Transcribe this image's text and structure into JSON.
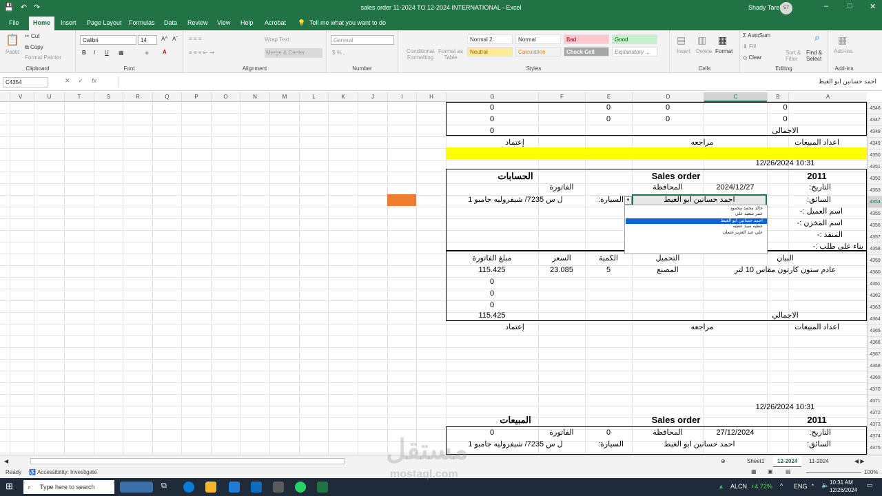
{
  "window": {
    "title": "sales order 11-2024 TO 12-2024 INTERNATIONAL  -  Excel",
    "user": "Shady Tarek",
    "avatar": "ST",
    "controls": [
      "–",
      "□",
      "✕"
    ]
  },
  "menu": {
    "tabs": [
      "File",
      "Home",
      "Insert",
      "Page Layout",
      "Formulas",
      "Data",
      "Review",
      "View",
      "Help",
      "Acrobat"
    ],
    "tell": "Tell me what you want to do"
  },
  "ribbon": {
    "clipboard": {
      "paste": "Paste",
      "cut": "Cut",
      "copy": "Copy",
      "painter": "Format Painter",
      "label": "Clipboard"
    },
    "font": {
      "name": "Calibri",
      "size": "14",
      "label": "Font"
    },
    "alignment": {
      "wrap": "Wrap Text",
      "merge": "Merge & Center",
      "label": "Alignment"
    },
    "number": {
      "format": "General",
      "label": "Number"
    },
    "styles": {
      "cond": "Conditional Formatting",
      "table": "Format as Table",
      "items": [
        "Normal 2",
        "Normal",
        "Bad",
        "Good",
        "Neutral",
        "Calculation",
        "Check Cell",
        "Explanatory ..."
      ],
      "label": "Styles"
    },
    "cells": {
      "insert": "Insert",
      "delete": "Delete",
      "format": "Format",
      "label": "Cells"
    },
    "editing": {
      "autosum": "AutoSum",
      "fill": "Fill",
      "clear": "Clear",
      "sort": "Sort & Filter",
      "find": "Find & Select",
      "label": "Editing"
    },
    "addins": {
      "btn": "Add-ins",
      "label": "Add-ins"
    }
  },
  "formula": {
    "namebox": "C4354",
    "value": "احمد حسانين ابو الغيط"
  },
  "columns": [
    "V",
    "U",
    "T",
    "S",
    "R",
    "Q",
    "P",
    "O",
    "N",
    "M",
    "L",
    "K",
    "J",
    "I",
    "H",
    "G",
    "F",
    "E",
    "D",
    "C",
    "B",
    "A"
  ],
  "rows": [
    "4346",
    "4347",
    "4348",
    "4349",
    "4350",
    "4351",
    "4352",
    "4353",
    "4354",
    "4355",
    "4356",
    "4357",
    "4358",
    "4359",
    "4360",
    "4361",
    "4362",
    "4363",
    "4364",
    "4365",
    "4366",
    "4367",
    "4368",
    "4369",
    "4370",
    "4371",
    "4372",
    "4373",
    "4374",
    "4375"
  ],
  "sheet": {
    "zero": "0",
    "total": "الاجمالي",
    "total2": "الاجمالى",
    "sales_count": "اعداد المبيعات",
    "review": "مراجعه",
    "approve": "إعتماد",
    "datetime": "12/26/2024 10:31",
    "year": "2011",
    "sales_order": "Sales order",
    "accounts": "الحسابات",
    "sales": "المبيعات",
    "date_lbl": "التاريخ:",
    "date1": "2024/12/27",
    "date2": "27/12/2024",
    "province": "المحافظة",
    "invoice": "الفاتورة",
    "driver_lbl": "السائق:",
    "driver": "احمد حسانين ابو الغيط",
    "car_lbl": "السيارة:",
    "car": "ل س 7235/ شيفروليه جامبو 1",
    "client": "اسم العميل :-",
    "store": "اسم المخزن :-",
    "outlet": "المنفذ :-",
    "request": "بناء على طلب :-",
    "statement": "البيان",
    "loading": "التحميل",
    "qty": "الكمية",
    "price": "السعر",
    "amount": "مبلغ الفاتورة",
    "item": "عادم ستون كارتون مقاس 10 لتر",
    "factory": "المصنع",
    "qty_val": "5",
    "price_val": "23.085",
    "amount_val": "115.425"
  },
  "dropdown": [
    "خالد  محمد محمود",
    "عمر سعيد علي",
    "احمد حسانين ابو الغيط",
    "عطيه سيد عطيه",
    "علي عبد العزيز عثمان"
  ],
  "sheets": [
    "Sheet1",
    "12-2024",
    "11-2024"
  ],
  "status": {
    "ready": "Ready",
    "access": "Accessibility: Investigate",
    "zoom": "100%"
  },
  "taskbar": {
    "search": "Type here to search",
    "alcn": "ALCN",
    "pct": "+4.72%",
    "lang": "ENG",
    "time": "10:31 AM",
    "date": "12/26/2024"
  },
  "watermark": {
    "ar": "مستقل",
    "en": "mostaql.com"
  },
  "colors": {
    "excel_green": "#217346",
    "highlight": "#ffff00",
    "orange": "#ed7d31",
    "selection": "#0a64d8"
  }
}
